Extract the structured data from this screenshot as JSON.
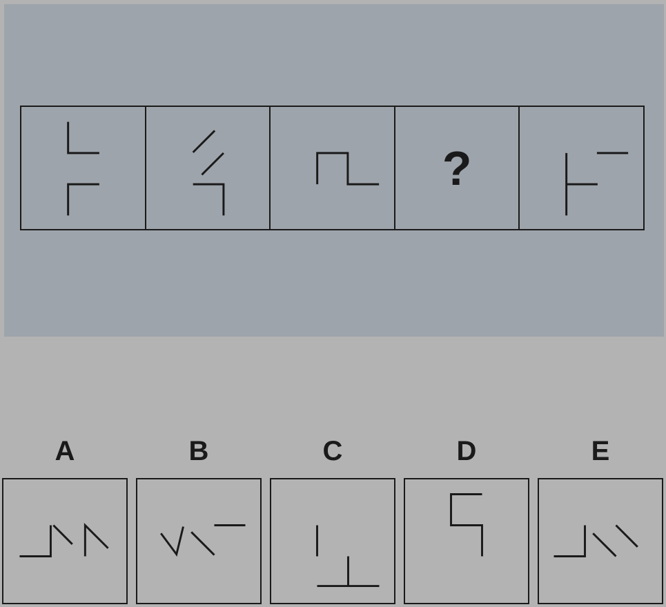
{
  "question": {
    "unknown_symbol": "?"
  },
  "options": [
    {
      "label": "A"
    },
    {
      "label": "B"
    },
    {
      "label": "C"
    },
    {
      "label": "D"
    },
    {
      "label": "E"
    }
  ]
}
